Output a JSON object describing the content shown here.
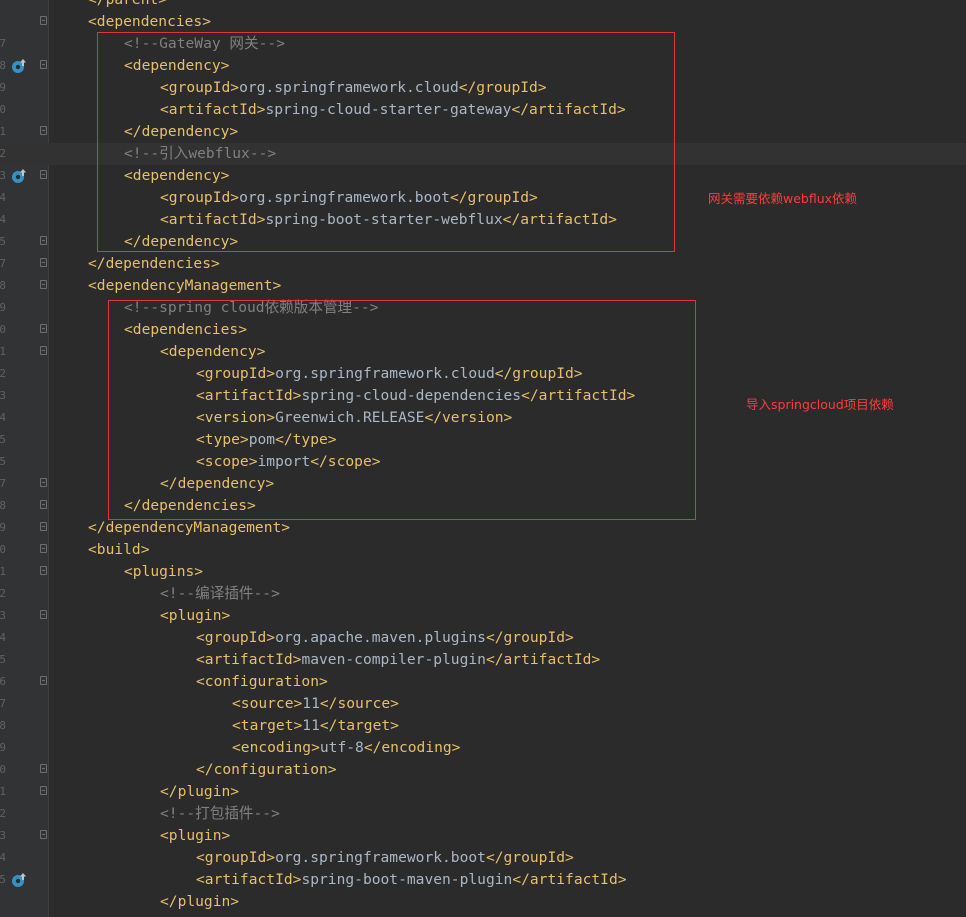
{
  "lines": [
    {
      "n": "",
      "text": "</parent>",
      "kind": "tag"
    },
    {
      "n": "",
      "text": "<dependencies>",
      "kind": "tag"
    },
    {
      "n": "7",
      "text": "<!--GateWay 网关-->",
      "kind": "comment"
    },
    {
      "n": "8",
      "text": "<dependency>",
      "kind": "tag"
    },
    {
      "n": "9",
      "text": "<groupId>org.springframework.cloud</groupId>",
      "kind": "elem",
      "open": "<groupId>",
      "value": "org.springframework.cloud",
      "close": "</groupId>"
    },
    {
      "n": "0",
      "text": "<artifactId>spring-cloud-starter-gateway</artifactId>",
      "kind": "elem",
      "open": "<artifactId>",
      "value": "spring-cloud-starter-gateway",
      "close": "</artifactId>"
    },
    {
      "n": "1",
      "text": "</dependency>",
      "kind": "tag"
    },
    {
      "n": "2",
      "text": "<!--引入webflux-->",
      "kind": "comment"
    },
    {
      "n": "3",
      "text": "<dependency>",
      "kind": "tag"
    },
    {
      "n": "4",
      "text": "<groupId>org.springframework.boot</groupId>",
      "kind": "elem",
      "open": "<groupId>",
      "value": "org.springframework.boot",
      "close": "</groupId>"
    },
    {
      "n": "4",
      "text": "<artifactId>spring-boot-starter-webflux</artifactId>",
      "kind": "elem",
      "open": "<artifactId>",
      "value": "spring-boot-starter-webflux",
      "close": "</artifactId>"
    },
    {
      "n": "5",
      "text": "</dependency>",
      "kind": "tag"
    },
    {
      "n": "7",
      "text": "</dependencies>",
      "kind": "tag"
    },
    {
      "n": "8",
      "text": "<dependencyManagement>",
      "kind": "tag"
    },
    {
      "n": "9",
      "text": "<!--spring cloud依赖版本管理-->",
      "kind": "comment"
    },
    {
      "n": "0",
      "text": "<dependencies>",
      "kind": "tag"
    },
    {
      "n": "1",
      "text": "<dependency>",
      "kind": "tag"
    },
    {
      "n": "2",
      "text": "<groupId>org.springframework.cloud</groupId>",
      "kind": "elem",
      "open": "<groupId>",
      "value": "org.springframework.cloud",
      "close": "</groupId>"
    },
    {
      "n": "3",
      "text": "<artifactId>spring-cloud-dependencies</artifactId>",
      "kind": "elem",
      "open": "<artifactId>",
      "value": "spring-cloud-dependencies",
      "close": "</artifactId>"
    },
    {
      "n": "4",
      "text": "<version>Greenwich.RELEASE</version>",
      "kind": "elem",
      "open": "<version>",
      "value": "Greenwich.RELEASE",
      "close": "</version>"
    },
    {
      "n": "5",
      "text": "<type>pom</type>",
      "kind": "elem",
      "open": "<type>",
      "value": "pom",
      "close": "</type>"
    },
    {
      "n": "5",
      "text": "<scope>import</scope>",
      "kind": "elem",
      "open": "<scope>",
      "value": "import",
      "close": "</scope>"
    },
    {
      "n": "7",
      "text": "</dependency>",
      "kind": "tag"
    },
    {
      "n": "8",
      "text": "</dependencies>",
      "kind": "tag"
    },
    {
      "n": "9",
      "text": "</dependencyManagement>",
      "kind": "tag"
    },
    {
      "n": "0",
      "text": "<build>",
      "kind": "tag"
    },
    {
      "n": "1",
      "text": "<plugins>",
      "kind": "tag"
    },
    {
      "n": "2",
      "text": "<!--编译插件-->",
      "kind": "comment"
    },
    {
      "n": "3",
      "text": "<plugin>",
      "kind": "tag"
    },
    {
      "n": "4",
      "text": "<groupId>org.apache.maven.plugins</groupId>",
      "kind": "elem",
      "open": "<groupId>",
      "value": "org.apache.maven.plugins",
      "close": "</groupId>"
    },
    {
      "n": "5",
      "text": "<artifactId>maven-compiler-plugin</artifactId>",
      "kind": "elem",
      "open": "<artifactId>",
      "value": "maven-compiler-plugin",
      "close": "</artifactId>"
    },
    {
      "n": "6",
      "text": "<configuration>",
      "kind": "tag"
    },
    {
      "n": "7",
      "text": "<source>11</source>",
      "kind": "elem",
      "open": "<source>",
      "value": "11",
      "close": "</source>"
    },
    {
      "n": "8",
      "text": "<target>11</target>",
      "kind": "elem",
      "open": "<target>",
      "value": "11",
      "close": "</target>"
    },
    {
      "n": "9",
      "text": "<encoding>utf-8</encoding>",
      "kind": "elem",
      "open": "<encoding>",
      "value": "utf-8",
      "close": "</encoding>"
    },
    {
      "n": "0",
      "text": "</configuration>",
      "kind": "tag"
    },
    {
      "n": "1",
      "text": "</plugin>",
      "kind": "tag"
    },
    {
      "n": "2",
      "text": "<!--打包插件-->",
      "kind": "comment"
    },
    {
      "n": "3",
      "text": "<plugin>",
      "kind": "tag"
    },
    {
      "n": "4",
      "text": "<groupId>org.springframework.boot</groupId>",
      "kind": "elem",
      "open": "<groupId>",
      "value": "org.springframework.boot",
      "close": "</groupId>"
    },
    {
      "n": "5",
      "text": "<artifactId>spring-boot-maven-plugin</artifactId>",
      "kind": "elem",
      "open": "<artifactId>",
      "value": "spring-boot-maven-plugin",
      "close": "</artifactId>"
    },
    {
      "n": "",
      "text": "</plugin>",
      "kind": "tag"
    }
  ],
  "annotations": {
    "webflux_note": "网关需要依赖webflux依赖",
    "springcloud_note": "导入springcloud项目依赖"
  },
  "gutter_icons": [
    "override-icon",
    "override-icon",
    "override-icon"
  ],
  "colors": {
    "background": "#2b2b2b",
    "tag": "#e8bf6a",
    "text": "#a9b7c6",
    "comment": "#808080",
    "annotation": "#ff3b3b",
    "box": "#e0373f"
  }
}
